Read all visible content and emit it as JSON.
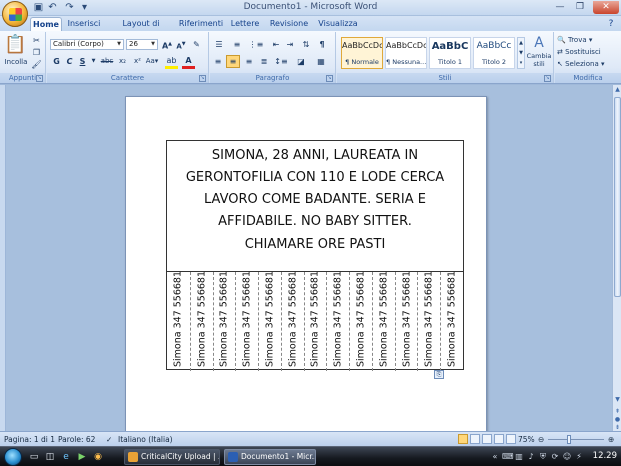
{
  "window": {
    "title": "Documento1 - Microsoft Word"
  },
  "tabs": [
    "Home",
    "Inserisci",
    "Layout di pagina",
    "Riferimenti",
    "Lettere",
    "Revisione",
    "Visualizza"
  ],
  "ribbon": {
    "clipboard": {
      "label": "Appunti",
      "paste_label": "Incolla"
    },
    "font": {
      "label": "Carattere",
      "font_name": "Calibri (Corpo)",
      "font_size": "26"
    },
    "paragraph": {
      "label": "Paragrafo"
    },
    "styles": {
      "label": "Stili",
      "items": [
        {
          "preview": "AaBbCcDc",
          "name": "¶ Normale"
        },
        {
          "preview": "AaBbCcDc",
          "name": "¶ Nessuna..."
        },
        {
          "preview": "AaBbC",
          "name": "Titolo 1"
        },
        {
          "preview": "AaBbCc",
          "name": "Titolo 2"
        }
      ],
      "change_styles_label": "Cambia stili"
    },
    "editing": {
      "label": "Modifica",
      "find": "Trova",
      "replace": "Sostituisci",
      "select": "Seleziona"
    }
  },
  "document": {
    "ad_lines": [
      "SIMONA, 28 ANNI, LAUREATA IN",
      "GERONTOFILIA CON 110 E LODE CERCA",
      "LAVORO COME BADANTE. SERIA E",
      "AFFIDABILE. NO BABY SITTER."
    ],
    "call_to_action": "CHIAMARE ORE PASTI",
    "tear_off_tabs": [
      "Simona 347 556681",
      "Simona 347 556681",
      "Simona 347 556681",
      "Simona 347 556681",
      "Simona 347 556681",
      "Simona 347 556681",
      "Simona 347 556681",
      "Simona 347 556681",
      "Simona 347 556681",
      "Simona 347 556681",
      "Simona 347 556681",
      "Simona 347 556681",
      "Simona 347 556681"
    ]
  },
  "statusbar": {
    "page": "Pagina: 1 di 1",
    "words": "Parole: 62",
    "language": "Italiano (Italia)",
    "zoom": "75%"
  },
  "taskbar": {
    "tasks": [
      {
        "label": "CriticalCity Upload | ...",
        "icon_color": "#e8a236"
      },
      {
        "label": "Documento1 - Micr...",
        "icon_color": "#2b5fb3"
      }
    ],
    "clock": "12.29"
  }
}
